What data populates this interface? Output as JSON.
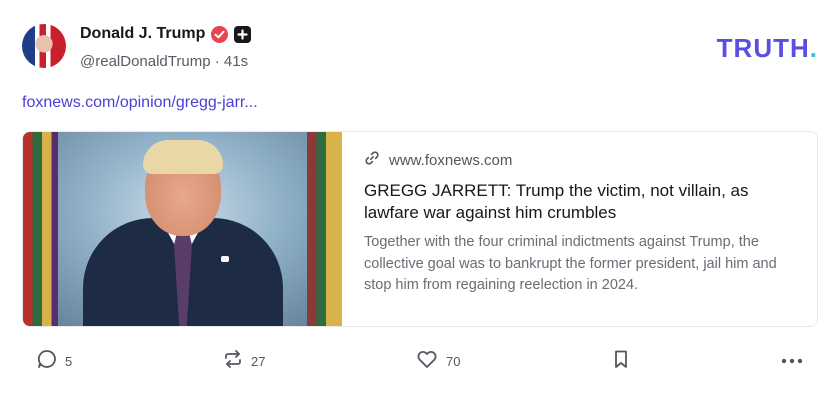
{
  "author": {
    "name": "Donald J. Trump",
    "handle": "@realDonaldTrump",
    "separator": "·",
    "time": "41s"
  },
  "brand": {
    "logo_text": "TRUTH",
    "logo_dot": "."
  },
  "post": {
    "link_text": "foxnews.com/opinion/gregg-jarr..."
  },
  "card": {
    "domain": "www.foxnews.com",
    "title": "GREGG JARRETT: Trump the victim, not villain, as lawfare war against him crumbles",
    "description": "Together with the four criminal indictments against Trump, the collective goal was to bankrupt the former president, jail him and stop him from regaining reelection in 2024."
  },
  "actions": {
    "replies": "5",
    "retruths": "27",
    "likes": "70"
  },
  "colors": {
    "brand_purple": "#5b4fe0",
    "brand_teal": "#32c5c9",
    "link": "#4a3fd6",
    "verified": "#e6454f"
  }
}
